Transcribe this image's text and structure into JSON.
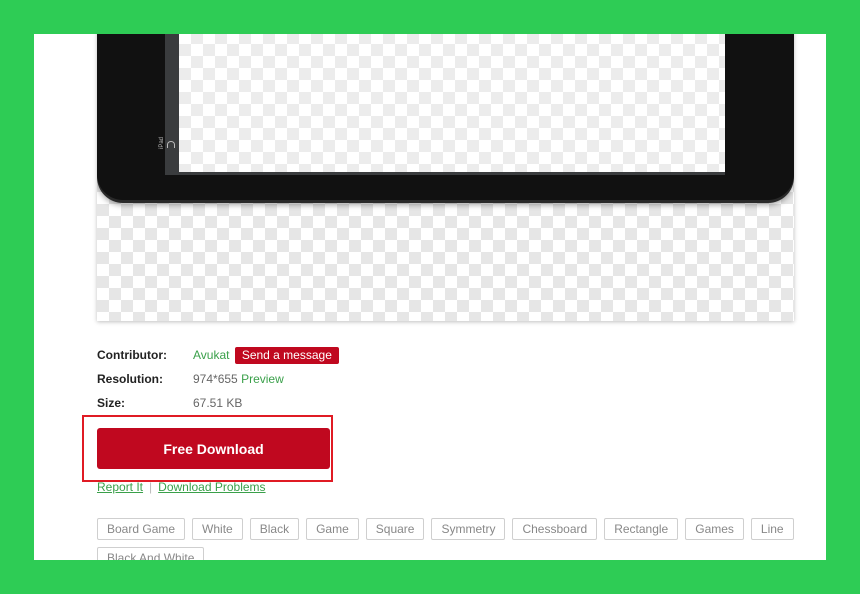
{
  "preview": {
    "device_label": "iPad"
  },
  "meta": {
    "contributor_label": "Contributor:",
    "contributor_name": "Avukat",
    "send_message_label": "Send a message",
    "resolution_label": "Resolution:",
    "resolution_value": "974*655",
    "preview_link": "Preview",
    "size_label": "Size:",
    "size_value": "67.51 KB"
  },
  "download": {
    "button_label": "Free Download"
  },
  "links": {
    "report": "Report It",
    "separator": "|",
    "problems": "Download Problems"
  },
  "tags": [
    "Board Game",
    "White",
    "Black",
    "Game",
    "Square",
    "Symmetry",
    "Chessboard",
    "Rectangle",
    "Games",
    "Line",
    "Black And White"
  ],
  "colors": {
    "accent_red": "#c0081f",
    "link_green": "#3aa04a",
    "frame_green": "#2ecc55",
    "highlight_red": "#e01b24"
  }
}
